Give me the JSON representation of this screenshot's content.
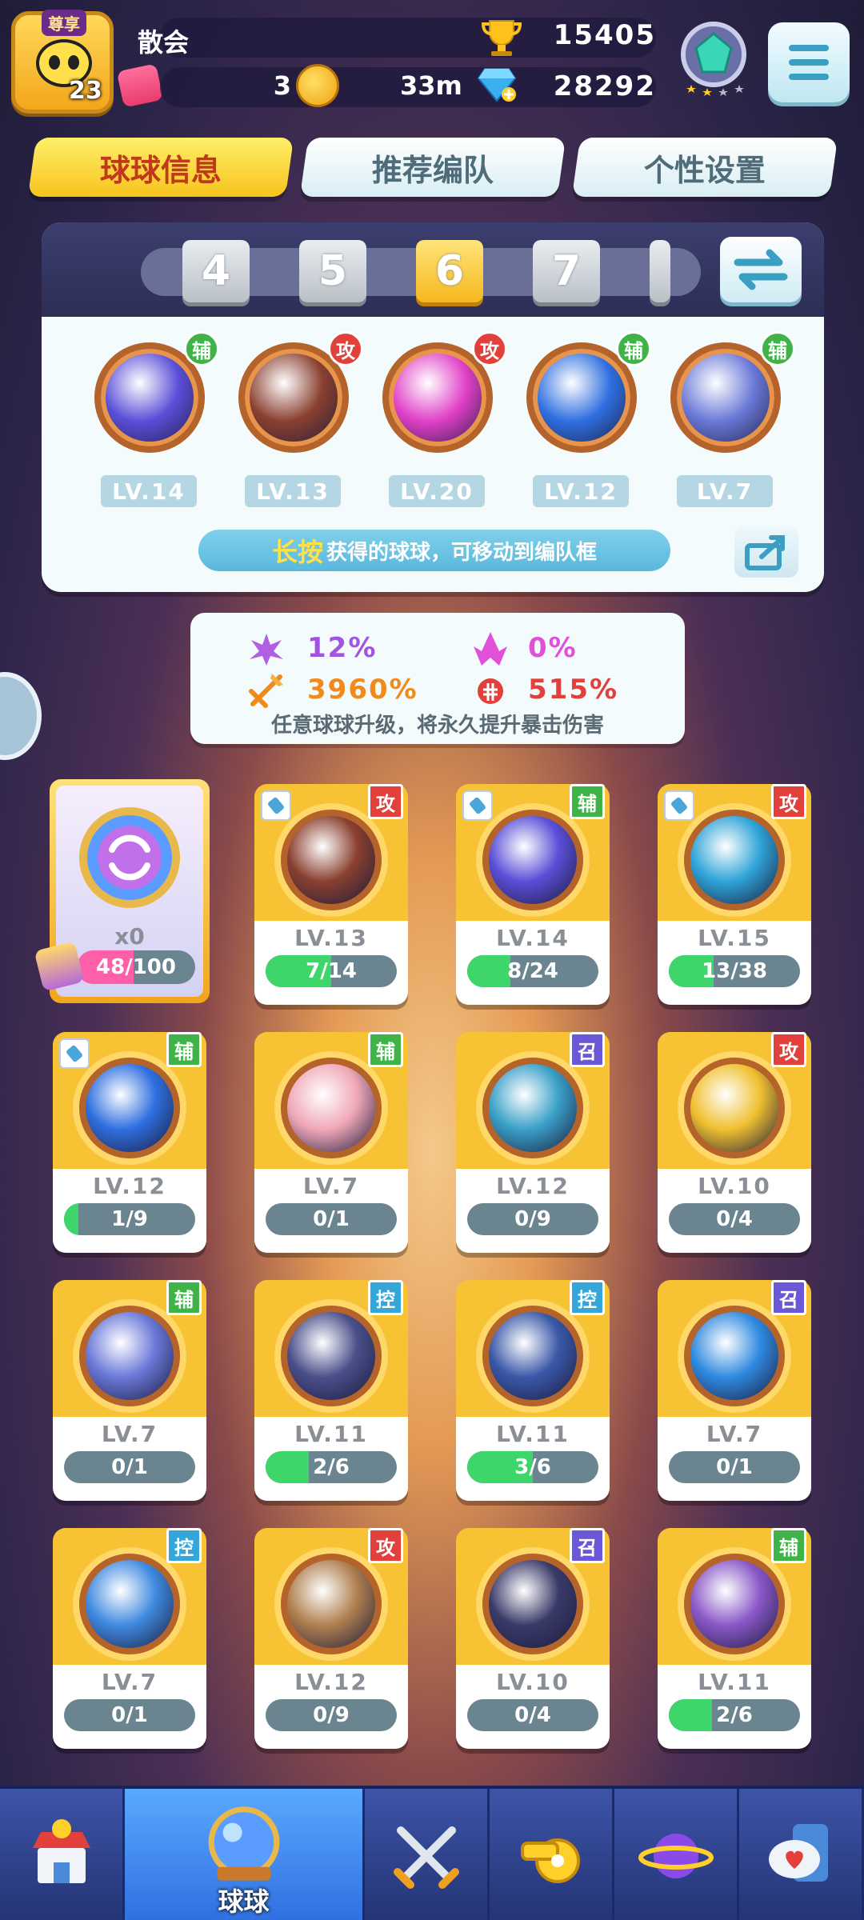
{
  "player": {
    "vip_label": "尊享",
    "level": "23",
    "name": "散会",
    "trophies": "15405",
    "coins": "3",
    "timer": "33m",
    "gems": "28292"
  },
  "tabs": [
    {
      "label": "球球信息",
      "active": true
    },
    {
      "label": "推荐编队",
      "active": false
    },
    {
      "label": "个性设置",
      "active": false
    }
  ],
  "team_slots": [
    "4",
    "5",
    "6",
    "7"
  ],
  "active_slot": "6",
  "team": [
    {
      "role": "辅",
      "level": "LV.14",
      "icon": "lightning-ball-icon",
      "color": "#5a4fd8"
    },
    {
      "role": "攻",
      "level": "LV.13",
      "icon": "infinity-ball-icon",
      "color": "#8a4030"
    },
    {
      "role": "攻",
      "level": "LV.20",
      "icon": "shield-bolt-ball-icon",
      "color": "#e040c8"
    },
    {
      "role": "辅",
      "level": "LV.12",
      "icon": "hexagon-ball-icon",
      "color": "#2f6fe0"
    },
    {
      "role": "辅",
      "level": "LV.7",
      "icon": "heart-girl-ball-icon",
      "color": "#6a78d8"
    }
  ],
  "hint": {
    "highlight": "长按",
    "text": "获得的球球，可移动到编队框"
  },
  "crit": {
    "rate_a": "12%",
    "rate_b": "0%",
    "dmg_a": "3960%",
    "dmg_b": "515%",
    "note": "任意球球升级，将永久提升暴击伤害"
  },
  "special_card": {
    "count": "x0",
    "progress": "48/100",
    "progress_value": 0.48
  },
  "cards": [
    {
      "role": "攻",
      "level": "LV.13",
      "progress": "7/14",
      "fill": 0.5,
      "pinned": true,
      "icon": "infinity-ball-icon",
      "color": "#8a4030"
    },
    {
      "role": "辅",
      "level": "LV.14",
      "progress": "8/24",
      "fill": 0.33,
      "pinned": true,
      "icon": "lightning-ball-icon",
      "color": "#5a4fd8"
    },
    {
      "role": "攻",
      "level": "LV.15",
      "progress": "13/38",
      "fill": 0.34,
      "pinned": true,
      "icon": "crystal-ball-icon",
      "color": "#2fa4d8"
    },
    {
      "role": "辅",
      "level": "LV.12",
      "progress": "1/9",
      "fill": 0.11,
      "pinned": true,
      "icon": "hexagon-ball-icon",
      "color": "#2f6fe0"
    },
    {
      "role": "辅",
      "level": "LV.7",
      "progress": "0/1",
      "fill": 0,
      "pinned": false,
      "icon": "pig-ball-icon",
      "color": "#f0a8b8"
    },
    {
      "role": "召",
      "level": "LV.12",
      "progress": "0/9",
      "fill": 0,
      "pinned": false,
      "icon": "fish-ball-icon",
      "color": "#3aa0c8"
    },
    {
      "role": "攻",
      "level": "LV.10",
      "progress": "0/4",
      "fill": 0,
      "pinned": false,
      "icon": "yellow-monster-ball-icon",
      "color": "#f0c030"
    },
    {
      "role": "辅",
      "level": "LV.7",
      "progress": "0/1",
      "fill": 0,
      "pinned": false,
      "icon": "heart-girl-ball-icon",
      "color": "#6a78d8"
    },
    {
      "role": "控",
      "level": "LV.11",
      "progress": "2/6",
      "fill": 0.33,
      "pinned": false,
      "icon": "swordsman-ball-icon",
      "color": "#4a4f8a"
    },
    {
      "role": "控",
      "level": "LV.11",
      "progress": "3/6",
      "fill": 0.5,
      "pinned": false,
      "icon": "warrior-ball-icon",
      "color": "#3a58a8"
    },
    {
      "role": "召",
      "level": "LV.7",
      "progress": "0/1",
      "fill": 0,
      "pinned": false,
      "icon": "shell-ball-icon",
      "color": "#2f8ae0"
    },
    {
      "role": "控",
      "level": "LV.7",
      "progress": "0/1",
      "fill": 0,
      "pinned": false,
      "icon": "top-hat-ball-icon",
      "color": "#3f8ae0"
    },
    {
      "role": "攻",
      "level": "LV.12",
      "progress": "0/9",
      "fill": 0,
      "pinned": false,
      "icon": "old-man-ball-icon",
      "color": "#b08050"
    },
    {
      "role": "召",
      "level": "LV.10",
      "progress": "0/4",
      "fill": 0,
      "pinned": false,
      "icon": "mustache-man-ball-icon",
      "color": "#3a3a6a"
    },
    {
      "role": "辅",
      "level": "LV.11",
      "progress": "2/6",
      "fill": 0.33,
      "pinned": false,
      "icon": "princess-ball-icon",
      "color": "#8a58c8"
    }
  ],
  "nav": [
    {
      "label": "",
      "icon": "shop-icon",
      "active": false
    },
    {
      "label": "球球",
      "icon": "balls-icon",
      "active": true
    },
    {
      "label": "",
      "icon": "crossed-swords-icon",
      "active": false
    },
    {
      "label": "",
      "icon": "whistle-icon",
      "active": false
    },
    {
      "label": "",
      "icon": "planet-icon",
      "active": false
    },
    {
      "label": "",
      "icon": "chat-heart-icon",
      "active": false
    }
  ],
  "colors": {
    "accent": "#f7c41c",
    "attack": "#e2403b",
    "support": "#3fb248",
    "summon": "#6a58d8",
    "control": "#35a6d9"
  }
}
